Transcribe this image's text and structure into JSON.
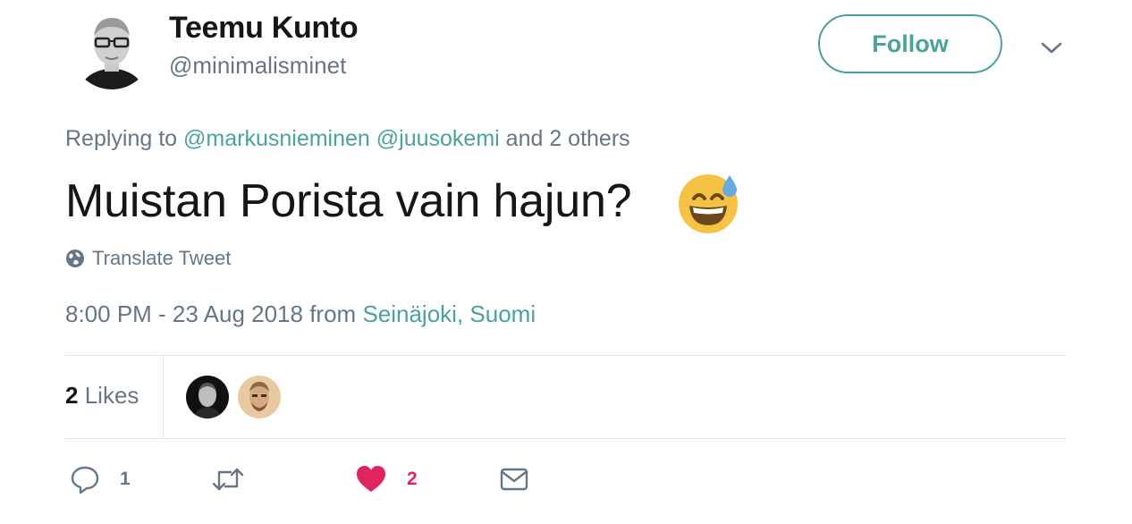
{
  "user": {
    "display_name": "Teemu Kunto",
    "handle": "@minimalisminet",
    "avatar_icon": "avatar-photo"
  },
  "header": {
    "follow_label": "Follow",
    "menu_icon": "chevron-down-icon"
  },
  "reply": {
    "prefix": "Replying to",
    "mention1": "@markusnieminen",
    "mention2": "@juusokemi",
    "suffix": "and 2 others"
  },
  "tweet": {
    "text": "Muistan Porista vain hajun?",
    "emoji_icon": "grinning-face-with-sweat-icon"
  },
  "translate": {
    "label": "Translate Tweet",
    "icon": "globe-icon"
  },
  "meta": {
    "time": "8:00 PM - 23 Aug 2018 from",
    "location": "Seinäjoki, Suomi"
  },
  "stats": {
    "likes_number": "2",
    "likes_word": "Likes"
  },
  "actions": {
    "reply_count": "1",
    "retweet_count": "",
    "like_count": "2"
  },
  "colors": {
    "accent": "#4aa39a",
    "muted": "#657786",
    "like": "#e0245e",
    "divider": "#e1e8ed"
  }
}
